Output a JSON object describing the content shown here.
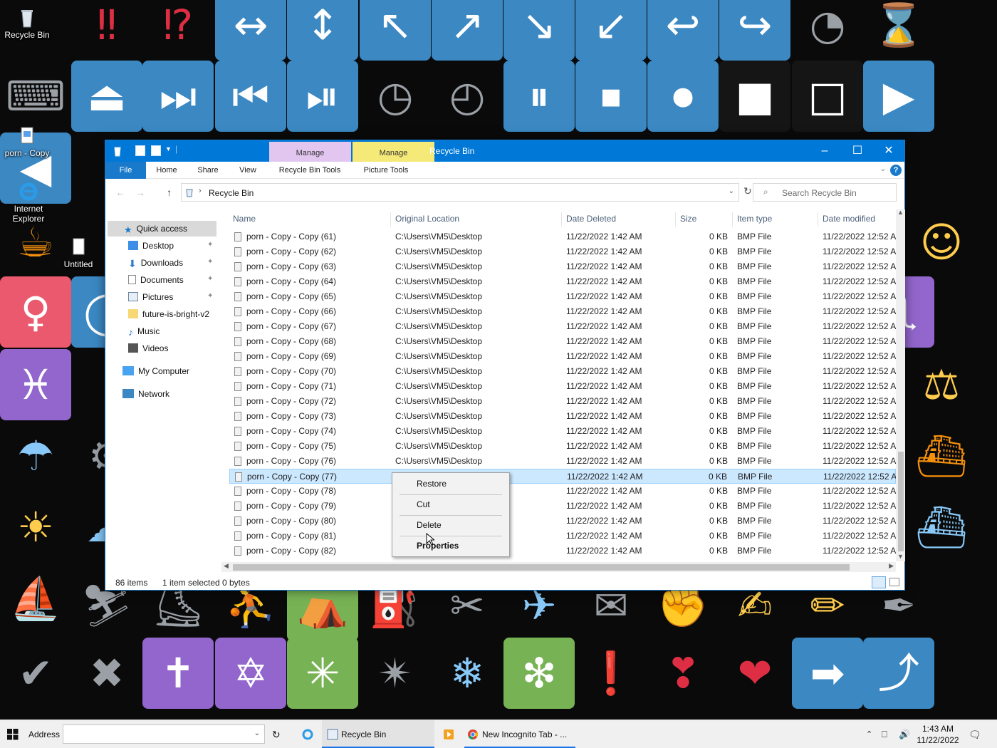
{
  "desktop": {
    "icons": [
      {
        "label": "Recycle Bin"
      },
      {
        "label": "porn - Copy"
      },
      {
        "label": "Internet Explorer"
      },
      {
        "label": "Untitled"
      }
    ]
  },
  "window": {
    "title": "Recycle Bin",
    "context_tabs": [
      {
        "label": "Manage",
        "color": "#e2c6f0"
      },
      {
        "label": "Manage",
        "color": "#f5e978"
      }
    ],
    "ribbon_tabs": [
      "File",
      "Home",
      "Share",
      "View",
      "Recycle Bin Tools",
      "Picture Tools"
    ],
    "help_glyph": "?",
    "address_path": "Recycle Bin",
    "search_placeholder": "Search Recycle Bin"
  },
  "nav": {
    "quick_access": "Quick access",
    "items": [
      "Desktop",
      "Downloads",
      "Documents",
      "Pictures",
      "future-is-bright-v2",
      "Music",
      "Videos"
    ],
    "my_computer": "My Computer",
    "network": "Network"
  },
  "columns": [
    "Name",
    "Original Location",
    "Date Deleted",
    "Size",
    "Item type",
    "Date modified"
  ],
  "files": {
    "rows": [
      {
        "name": "porn - Copy - Copy (61)",
        "location": "C:\\Users\\VM5\\Desktop",
        "deleted": "11/22/2022 1:42 AM",
        "size": "0 KB",
        "type": "BMP File",
        "modified": "11/22/2022 12:52 A"
      },
      {
        "name": "porn - Copy - Copy (62)",
        "location": "C:\\Users\\VM5\\Desktop",
        "deleted": "11/22/2022 1:42 AM",
        "size": "0 KB",
        "type": "BMP File",
        "modified": "11/22/2022 12:52 A"
      },
      {
        "name": "porn - Copy - Copy (63)",
        "location": "C:\\Users\\VM5\\Desktop",
        "deleted": "11/22/2022 1:42 AM",
        "size": "0 KB",
        "type": "BMP File",
        "modified": "11/22/2022 12:52 A"
      },
      {
        "name": "porn - Copy - Copy (64)",
        "location": "C:\\Users\\VM5\\Desktop",
        "deleted": "11/22/2022 1:42 AM",
        "size": "0 KB",
        "type": "BMP File",
        "modified": "11/22/2022 12:52 A"
      },
      {
        "name": "porn - Copy - Copy (65)",
        "location": "C:\\Users\\VM5\\Desktop",
        "deleted": "11/22/2022 1:42 AM",
        "size": "0 KB",
        "type": "BMP File",
        "modified": "11/22/2022 12:52 A"
      },
      {
        "name": "porn - Copy - Copy (66)",
        "location": "C:\\Users\\VM5\\Desktop",
        "deleted": "11/22/2022 1:42 AM",
        "size": "0 KB",
        "type": "BMP File",
        "modified": "11/22/2022 12:52 A"
      },
      {
        "name": "porn - Copy - Copy (67)",
        "location": "C:\\Users\\VM5\\Desktop",
        "deleted": "11/22/2022 1:42 AM",
        "size": "0 KB",
        "type": "BMP File",
        "modified": "11/22/2022 12:52 A"
      },
      {
        "name": "porn - Copy - Copy (68)",
        "location": "C:\\Users\\VM5\\Desktop",
        "deleted": "11/22/2022 1:42 AM",
        "size": "0 KB",
        "type": "BMP File",
        "modified": "11/22/2022 12:52 A"
      },
      {
        "name": "porn - Copy - Copy (69)",
        "location": "C:\\Users\\VM5\\Desktop",
        "deleted": "11/22/2022 1:42 AM",
        "size": "0 KB",
        "type": "BMP File",
        "modified": "11/22/2022 12:52 A"
      },
      {
        "name": "porn - Copy - Copy (70)",
        "location": "C:\\Users\\VM5\\Desktop",
        "deleted": "11/22/2022 1:42 AM",
        "size": "0 KB",
        "type": "BMP File",
        "modified": "11/22/2022 12:52 A"
      },
      {
        "name": "porn - Copy - Copy (71)",
        "location": "C:\\Users\\VM5\\Desktop",
        "deleted": "11/22/2022 1:42 AM",
        "size": "0 KB",
        "type": "BMP File",
        "modified": "11/22/2022 12:52 A"
      },
      {
        "name": "porn - Copy - Copy (72)",
        "location": "C:\\Users\\VM5\\Desktop",
        "deleted": "11/22/2022 1:42 AM",
        "size": "0 KB",
        "type": "BMP File",
        "modified": "11/22/2022 12:52 A"
      },
      {
        "name": "porn - Copy - Copy (73)",
        "location": "C:\\Users\\VM5\\Desktop",
        "deleted": "11/22/2022 1:42 AM",
        "size": "0 KB",
        "type": "BMP File",
        "modified": "11/22/2022 12:52 A"
      },
      {
        "name": "porn - Copy - Copy (74)",
        "location": "C:\\Users\\VM5\\Desktop",
        "deleted": "11/22/2022 1:42 AM",
        "size": "0 KB",
        "type": "BMP File",
        "modified": "11/22/2022 12:52 A"
      },
      {
        "name": "porn - Copy - Copy (75)",
        "location": "C:\\Users\\VM5\\Desktop",
        "deleted": "11/22/2022 1:42 AM",
        "size": "0 KB",
        "type": "BMP File",
        "modified": "11/22/2022 12:52 A"
      },
      {
        "name": "porn - Copy - Copy (76)",
        "location": "C:\\Users\\VM5\\Desktop",
        "deleted": "11/22/2022 1:42 AM",
        "size": "0 KB",
        "type": "BMP File",
        "modified": "11/22/2022 12:52 A"
      },
      {
        "name": "porn - Copy - Copy (77)",
        "location": "",
        "deleted": "11/22/2022 1:42 AM",
        "size": "0 KB",
        "type": "BMP File",
        "modified": "11/22/2022 12:52 A",
        "selected": true
      },
      {
        "name": "porn - Copy - Copy (78)",
        "location": "",
        "deleted": "11/22/2022 1:42 AM",
        "size": "0 KB",
        "type": "BMP File",
        "modified": "11/22/2022 12:52 A"
      },
      {
        "name": "porn - Copy - Copy (79)",
        "location": "",
        "deleted": "11/22/2022 1:42 AM",
        "size": "0 KB",
        "type": "BMP File",
        "modified": "11/22/2022 12:52 A"
      },
      {
        "name": "porn - Copy - Copy (80)",
        "location": "",
        "deleted": "11/22/2022 1:42 AM",
        "size": "0 KB",
        "type": "BMP File",
        "modified": "11/22/2022 12:52 A"
      },
      {
        "name": "porn - Copy - Copy (81)",
        "location": "",
        "deleted": "11/22/2022 1:42 AM",
        "size": "0 KB",
        "type": "BMP File",
        "modified": "11/22/2022 12:52 A"
      },
      {
        "name": "porn - Copy - Copy (82)",
        "location": "",
        "deleted": "11/22/2022 1:42 AM",
        "size": "0 KB",
        "type": "BMP File",
        "modified": "11/22/2022 12:52 A"
      }
    ]
  },
  "status": {
    "items": "86 items",
    "selected": "1 item selected",
    "bytes": "0 bytes"
  },
  "context_menu": [
    "Restore",
    "Cut",
    "Delete",
    "Properties"
  ],
  "taskbar": {
    "address_label": "Address",
    "apps": [
      "Recycle Bin",
      "New Incognito Tab - ..."
    ],
    "time": "1:43 AM",
    "date": "11/22/2022"
  },
  "colors": {
    "accent": "#0078d7",
    "selection": "#cce8ff"
  }
}
